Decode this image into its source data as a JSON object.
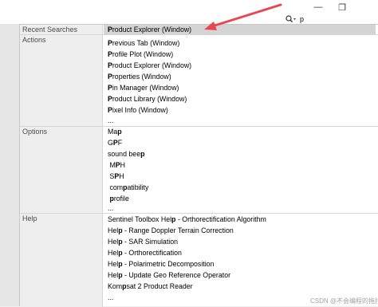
{
  "window_controls": {
    "minimize": "—",
    "restore": "❐"
  },
  "search": {
    "value": "p"
  },
  "sections": {
    "recent": {
      "label": "Recent Searches",
      "items": [
        {
          "pre": "",
          "bold": "P",
          "post": "roduct Explorer (Window)"
        }
      ]
    },
    "actions": {
      "label": "Actions",
      "items": [
        {
          "pre": "",
          "bold": "P",
          "post": "revious Tab (Window)"
        },
        {
          "pre": "",
          "bold": "P",
          "post": "rofile Plot (Window)"
        },
        {
          "pre": "",
          "bold": "P",
          "post": "roduct Explorer (Window)"
        },
        {
          "pre": "",
          "bold": "P",
          "post": "roperties (Window)"
        },
        {
          "pre": "",
          "bold": "P",
          "post": "in Manager (Window)"
        },
        {
          "pre": "",
          "bold": "P",
          "post": "roduct Library (Window)"
        },
        {
          "pre": "",
          "bold": "P",
          "post": "ixel Info (Window)"
        },
        {
          "pre": "...",
          "bold": "",
          "post": ""
        }
      ]
    },
    "options": {
      "label": "Options",
      "items": [
        {
          "pre": "Ma",
          "bold": "p",
          "post": ""
        },
        {
          "pre": "G",
          "bold": "P",
          "post": "F"
        },
        {
          "pre": "sound bee",
          "bold": "p",
          "post": ""
        },
        {
          "pre": " M",
          "bold": "P",
          "post": "H"
        },
        {
          "pre": " S",
          "bold": "P",
          "post": "H"
        },
        {
          "pre": " com",
          "bold": "p",
          "post": "atibility"
        },
        {
          "pre": " ",
          "bold": "p",
          "post": "rofile"
        },
        {
          "pre": "...",
          "bold": "",
          "post": ""
        }
      ]
    },
    "help": {
      "label": "Help",
      "items": [
        {
          "pre": "Sentinel Toolbox Hel",
          "bold": "p",
          "post": " - Orthorectification Algorithm"
        },
        {
          "pre": "Hel",
          "bold": "p",
          "post": " - Range Doppler Terrain Correction"
        },
        {
          "pre": "Hel",
          "bold": "p",
          "post": " - SAR Simulation"
        },
        {
          "pre": "Hel",
          "bold": "p",
          "post": " - Orthorectification"
        },
        {
          "pre": "Hel",
          "bold": "p",
          "post": " - Polarimetric Decomposition"
        },
        {
          "pre": "Hel",
          "bold": "p",
          "post": " - Update Geo Reference Operator"
        },
        {
          "pre": "Kom",
          "bold": "p",
          "post": "sat 2 Product Reader"
        },
        {
          "pre": "...",
          "bold": "",
          "post": ""
        }
      ]
    }
  },
  "watermark": "CSDN @不会编程的拖拉机",
  "colors": {
    "highlight": "#d4d4d4",
    "annotation_arrow": "#e8474f"
  }
}
